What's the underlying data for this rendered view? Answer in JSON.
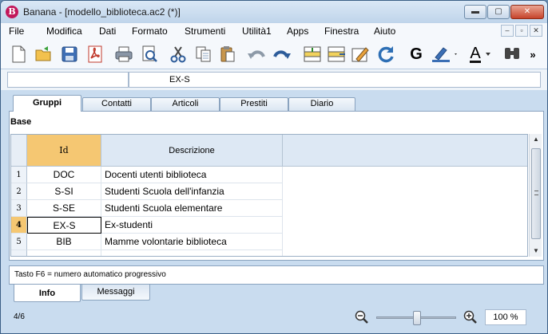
{
  "window": {
    "title": "Banana - [modello_biblioteca.ac2 (*)]",
    "app_icon_letter": "B",
    "min_glyph": "▬",
    "max_glyph": "▢",
    "close_glyph": "✕"
  },
  "menu": [
    "File",
    "Modifica",
    "Dati",
    "Formato",
    "Strumenti",
    "Utilità1",
    "Apps",
    "Finestra",
    "Aiuto"
  ],
  "mdi_buttons": [
    "–",
    "▫",
    "✕"
  ],
  "toolbar": {
    "icons": [
      "new-document-icon",
      "open-folder-icon",
      "save-icon",
      "pdf-icon",
      "print-icon",
      "print-preview-icon",
      "cut-icon",
      "copy-icon",
      "paste-icon",
      "undo-icon",
      "redo-icon",
      "insert-row-icon",
      "delete-row-icon",
      "edit-icon",
      "refresh-icon",
      "bold-icon",
      "highlight-color-icon",
      "font-color-icon",
      "find-icon"
    ],
    "bold_label": "G",
    "font_color_label": "A",
    "overflow_label": "»"
  },
  "address": {
    "cell_ref": "",
    "cell_value": "EX-S"
  },
  "tabs": [
    {
      "label": "Gruppi",
      "active": true
    },
    {
      "label": "Contatti",
      "active": false
    },
    {
      "label": "Articoli",
      "active": false
    },
    {
      "label": "Prestiti",
      "active": false
    },
    {
      "label": "Diario",
      "active": false
    }
  ],
  "view_label": "Base",
  "table": {
    "columns": [
      "Id",
      "Descrizione"
    ],
    "rows": [
      {
        "num": "1",
        "id": "DOC",
        "desc": "Docenti utenti biblioteca"
      },
      {
        "num": "2",
        "id": "S-SI",
        "desc": "Studenti Scuola dell'infanzia"
      },
      {
        "num": "3",
        "id": "S-SE",
        "desc": "Studenti Scuola elementare"
      },
      {
        "num": "4",
        "id": "EX-S",
        "desc": "Ex-studenti"
      },
      {
        "num": "5",
        "id": "BIB",
        "desc": "Mamme volontarie biblioteca"
      }
    ],
    "selected_row": 4
  },
  "info": {
    "text": "Tasto F6 = numero automatico progressivo"
  },
  "bottom_tabs": [
    {
      "label": "Info",
      "active": true
    },
    {
      "label": "Messaggi",
      "active": false
    }
  ],
  "status": {
    "position": "4/6",
    "zoom": "100 %",
    "zoom_level": 1.0
  }
}
